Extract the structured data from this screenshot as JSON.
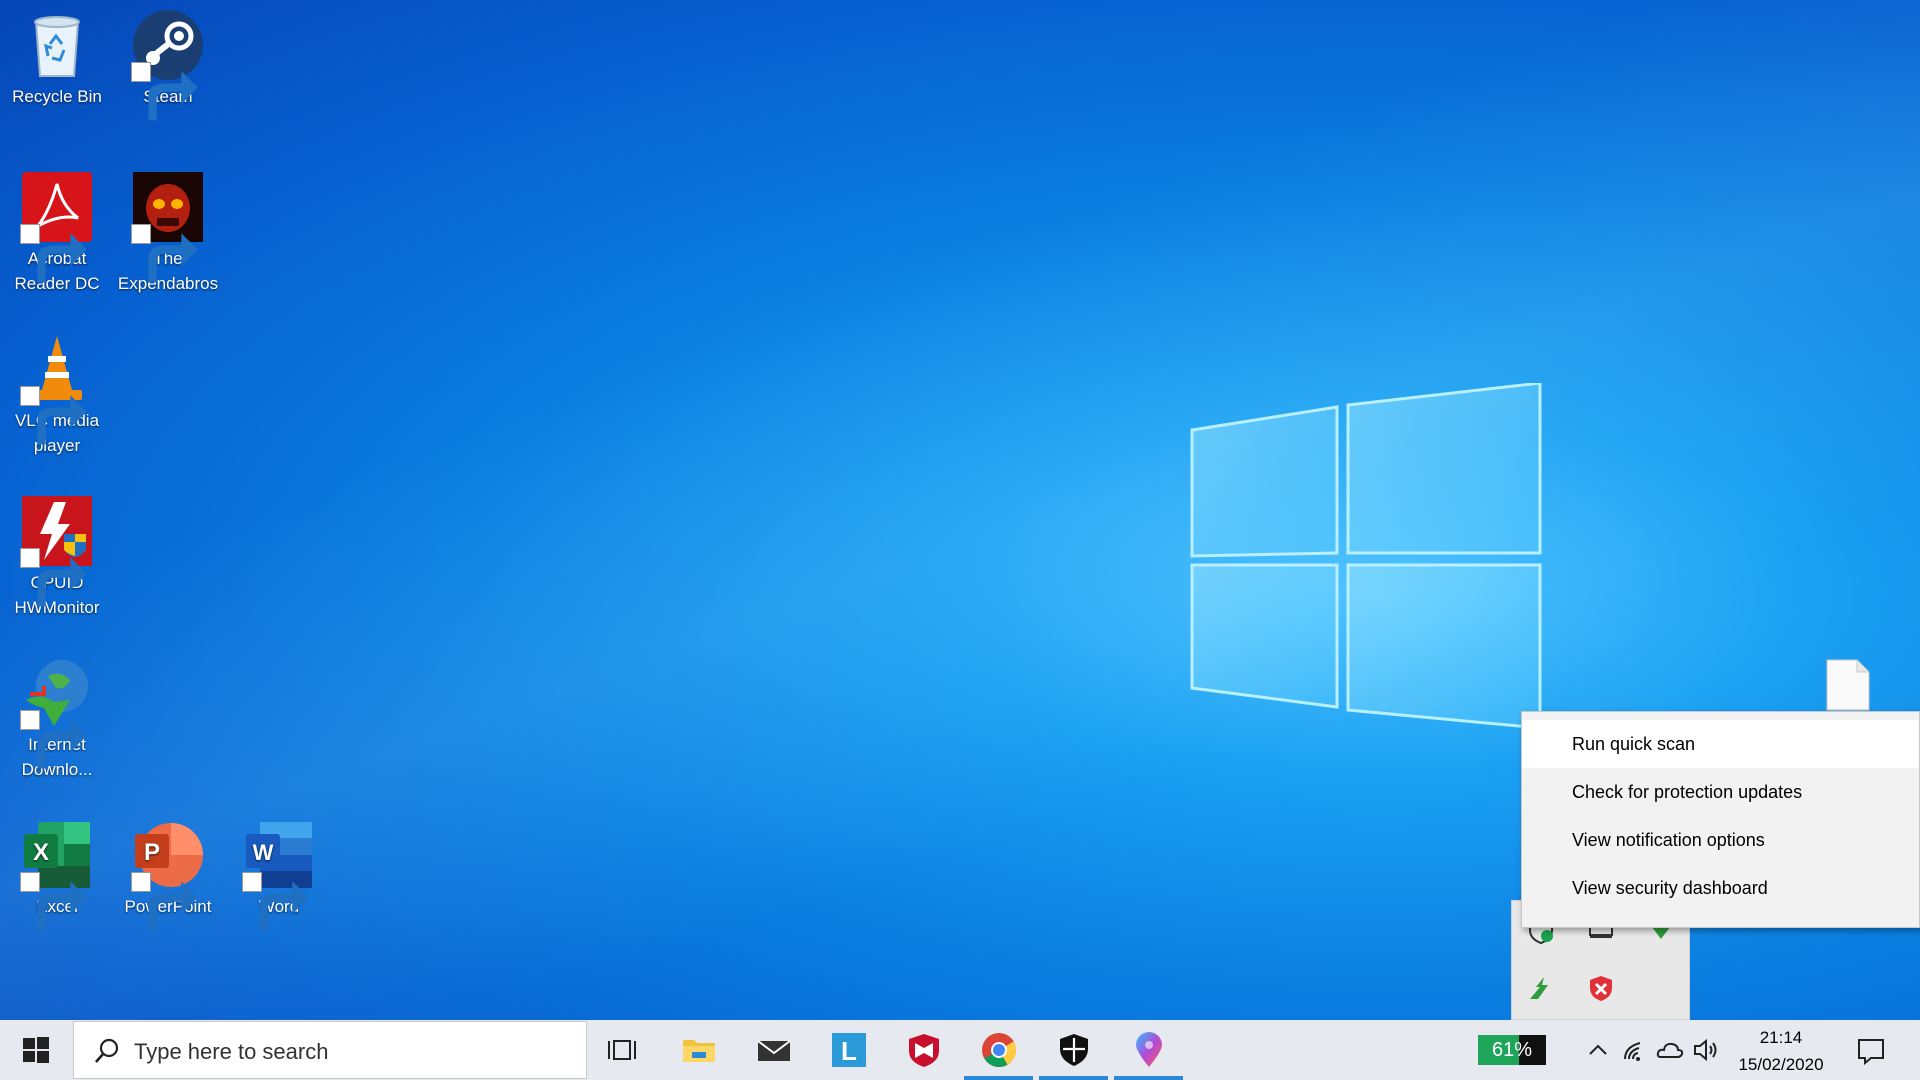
{
  "desktop": {
    "icons": [
      {
        "label": "Recycle Bin",
        "icon": "recycle-bin-icon"
      },
      {
        "label": "Steam",
        "icon": "steam-icon"
      },
      {
        "label": "Acrobat Reader DC",
        "icon": "acrobat-icon"
      },
      {
        "label": "The Expendabros",
        "icon": "expendabros-icon"
      },
      {
        "label": "VLC media player",
        "icon": "vlc-icon"
      },
      {
        "label": "CPUID HWMonitor",
        "icon": "hwmonitor-icon"
      },
      {
        "label": "Internet Downlo...",
        "icon": "internet-download-manager-icon"
      },
      {
        "label": "Excel",
        "icon": "excel-icon"
      },
      {
        "label": "PowerPoint",
        "icon": "powerpoint-icon"
      },
      {
        "label": "Word",
        "icon": "word-icon"
      }
    ]
  },
  "context_menu": {
    "items": [
      {
        "label": "Run quick scan"
      },
      {
        "label": "Check for protection updates"
      },
      {
        "label": "View notification options"
      },
      {
        "label": "View security dashboard"
      }
    ]
  },
  "taskbar": {
    "search_placeholder": "Type here to search",
    "apps": [
      "task-view-icon",
      "file-explorer-icon",
      "mail-icon",
      "l-app-icon",
      "mcafee-icon",
      "chrome-icon",
      "windows-security-icon",
      "maps-pin-icon"
    ],
    "battery_percent": 61,
    "battery_label": "61%",
    "time": "21:14",
    "date": "15/02/2020"
  },
  "colors": {
    "accent": "#2b89d9",
    "battery_fill": "#1fa55a",
    "desktop_blue": "#0a7ee0"
  }
}
